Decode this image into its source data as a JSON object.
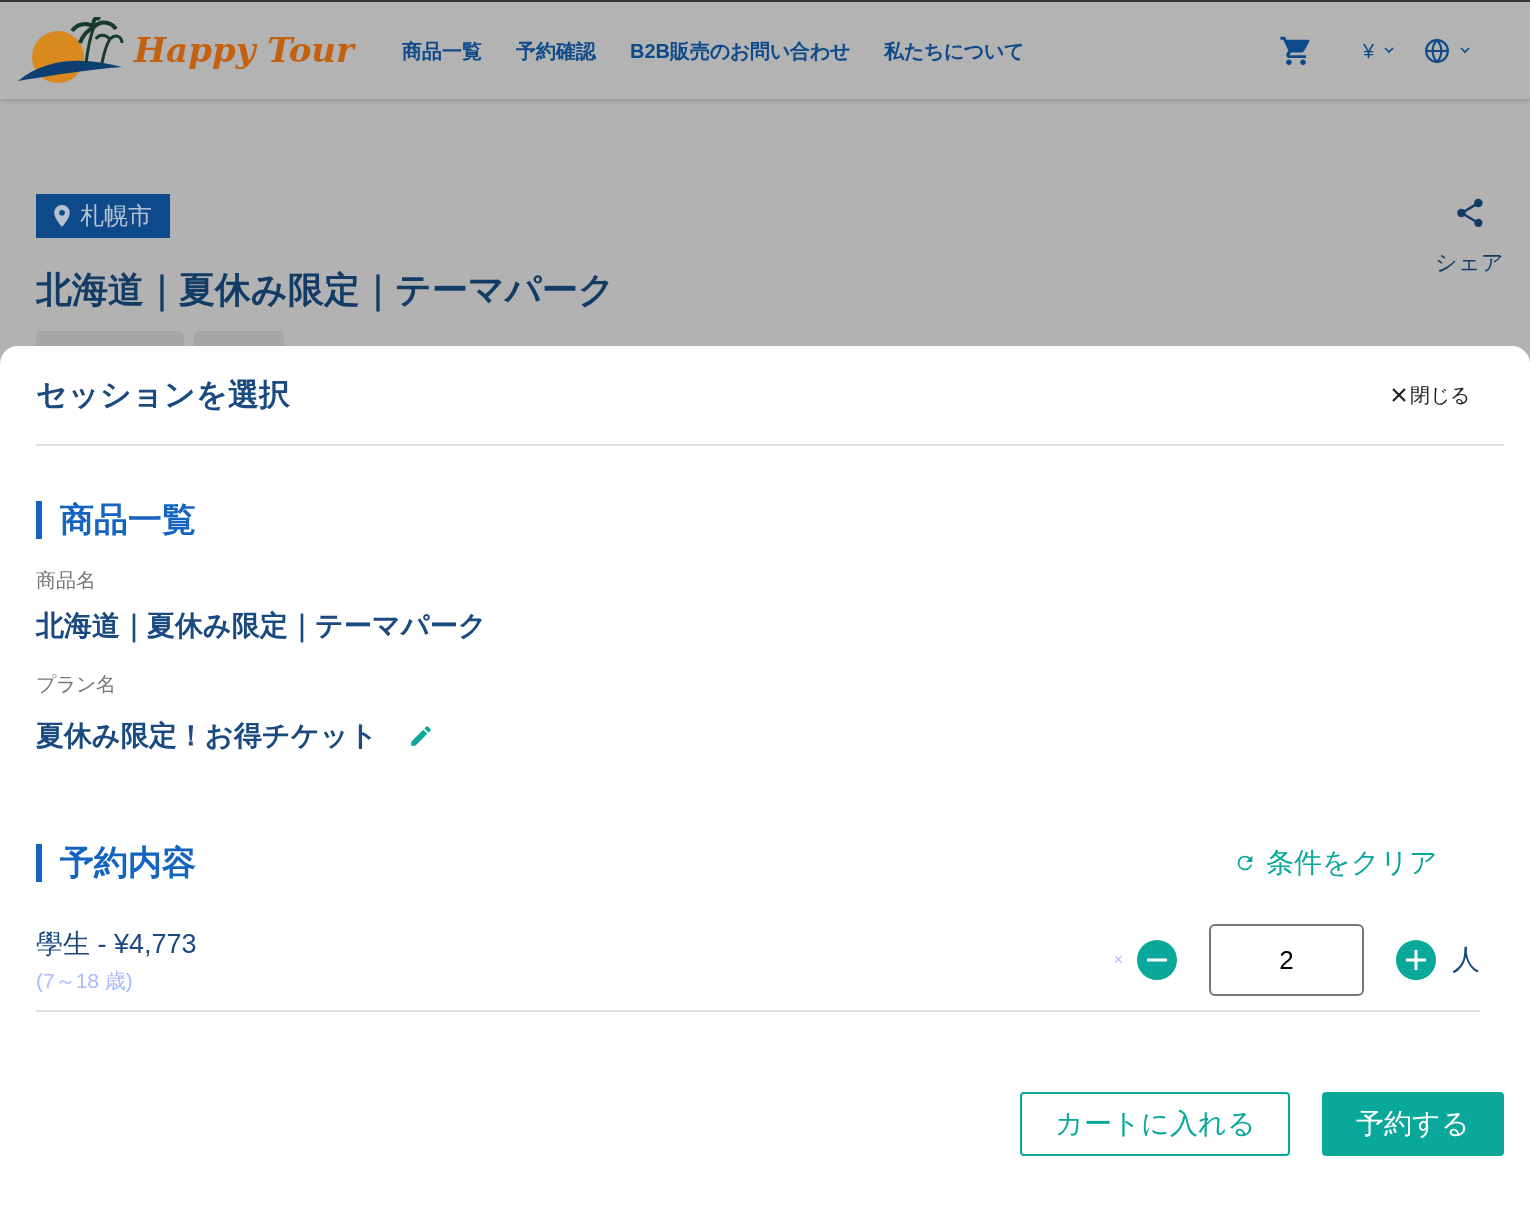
{
  "header": {
    "logo_text": "Happy Tour",
    "nav": [
      "商品一覧",
      "予約確認",
      "B2B販売のお問い合わせ",
      "私たちについて"
    ],
    "currency": "¥"
  },
  "page": {
    "location": "札幌市",
    "title": "北海道｜夏休み限定｜テーマパーク",
    "share_label": "シェア",
    "tags": [
      {
        "kind": "hidden_chip"
      },
      {
        "kind": "hidden_chip"
      }
    ]
  },
  "modal": {
    "title": "セッションを選択",
    "close_label": "閉じる",
    "product_section": {
      "heading": "商品一覧",
      "product_label": "商品名",
      "product_name": "北海道｜夏休み限定｜テーマパーク",
      "plan_label": "プラン名",
      "plan_name": "夏休み限定！お得チケット"
    },
    "reservation": {
      "heading": "予約内容",
      "clear_label": "条件をクリア",
      "tickets": [
        {
          "name_price": "學生 - ¥4,773",
          "age_range": "(7～18 歳)",
          "remove_mark": "×",
          "quantity": "2",
          "unit": "人"
        }
      ]
    },
    "buttons": {
      "cart": "カートに入れる",
      "book": "予約する"
    }
  }
}
